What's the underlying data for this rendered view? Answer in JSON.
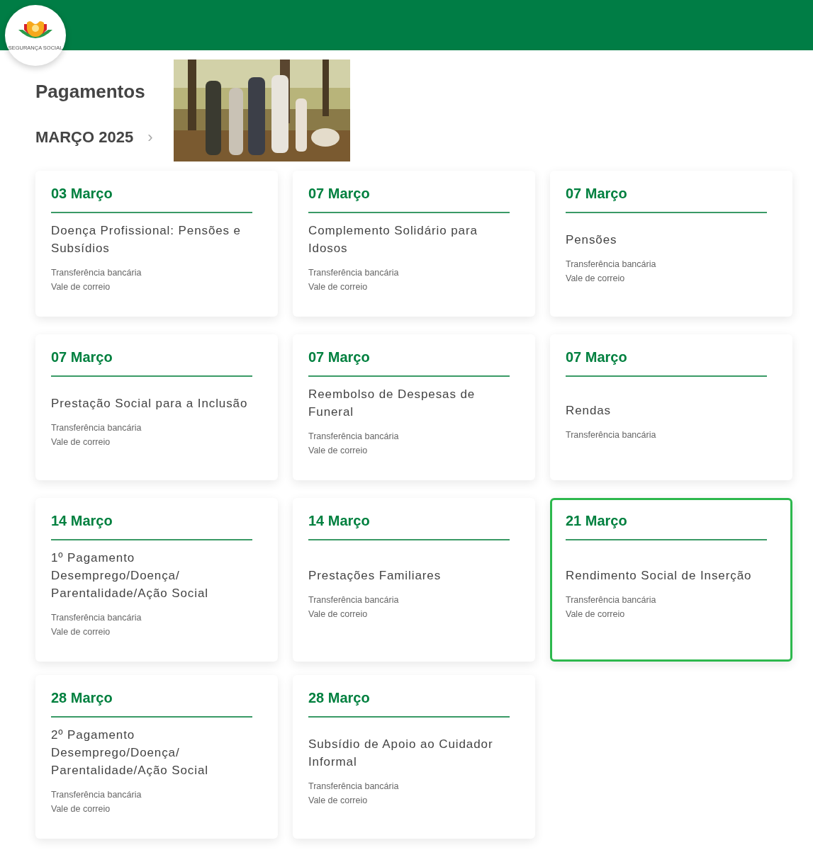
{
  "logo": {
    "text": "SEGURANÇA SOCIAL"
  },
  "page_title": "Pagamentos",
  "month": {
    "label": "MARÇO 2025",
    "chevron": "›"
  },
  "cards": [
    {
      "date": "03 Março",
      "title": "Doença Profissional: Pensões e Subsídios",
      "methods": [
        "Transferência bancária",
        "Vale de correio"
      ],
      "highlighted": false
    },
    {
      "date": "07 Março",
      "title": "Complemento Solidário para Idosos",
      "methods": [
        "Transferência bancária",
        "Vale de correio"
      ],
      "highlighted": false
    },
    {
      "date": "07 Março",
      "title": "Pensões",
      "methods": [
        "Transferência bancária",
        "Vale de correio"
      ],
      "highlighted": false
    },
    {
      "date": "07 Março",
      "title": "Prestação Social para a Inclusão",
      "methods": [
        "Transferência bancária",
        "Vale de correio"
      ],
      "highlighted": false
    },
    {
      "date": "07 Março",
      "title": "Reembolso de Despesas de Funeral",
      "methods": [
        "Transferência bancária",
        "Vale de correio"
      ],
      "highlighted": false
    },
    {
      "date": "07 Março",
      "title": "Rendas",
      "methods": [
        "Transferência bancária"
      ],
      "highlighted": false
    },
    {
      "date": "14 Março",
      "title": "1º Pagamento Desemprego/Doença/ Parentalidade/Ação Social",
      "methods": [
        "Transferência bancária",
        "Vale de correio"
      ],
      "highlighted": false
    },
    {
      "date": "14 Março",
      "title": "Prestações Familiares",
      "methods": [
        "Transferência bancária",
        "Vale de correio"
      ],
      "highlighted": false
    },
    {
      "date": "21 Março",
      "title": "Rendimento Social de Inserção",
      "methods": [
        "Transferência bancária",
        "Vale de correio"
      ],
      "highlighted": true
    },
    {
      "date": "28 Março",
      "title": "2º Pagamento Desemprego/Doença/ Parentalidade/Ação Social",
      "methods": [
        "Transferência bancária",
        "Vale de correio"
      ],
      "highlighted": false
    },
    {
      "date": "28 Março",
      "title": "Subsídio de Apoio ao Cuidador Informal",
      "methods": [
        "Transferência bancária",
        "Vale de correio"
      ],
      "highlighted": false
    }
  ]
}
